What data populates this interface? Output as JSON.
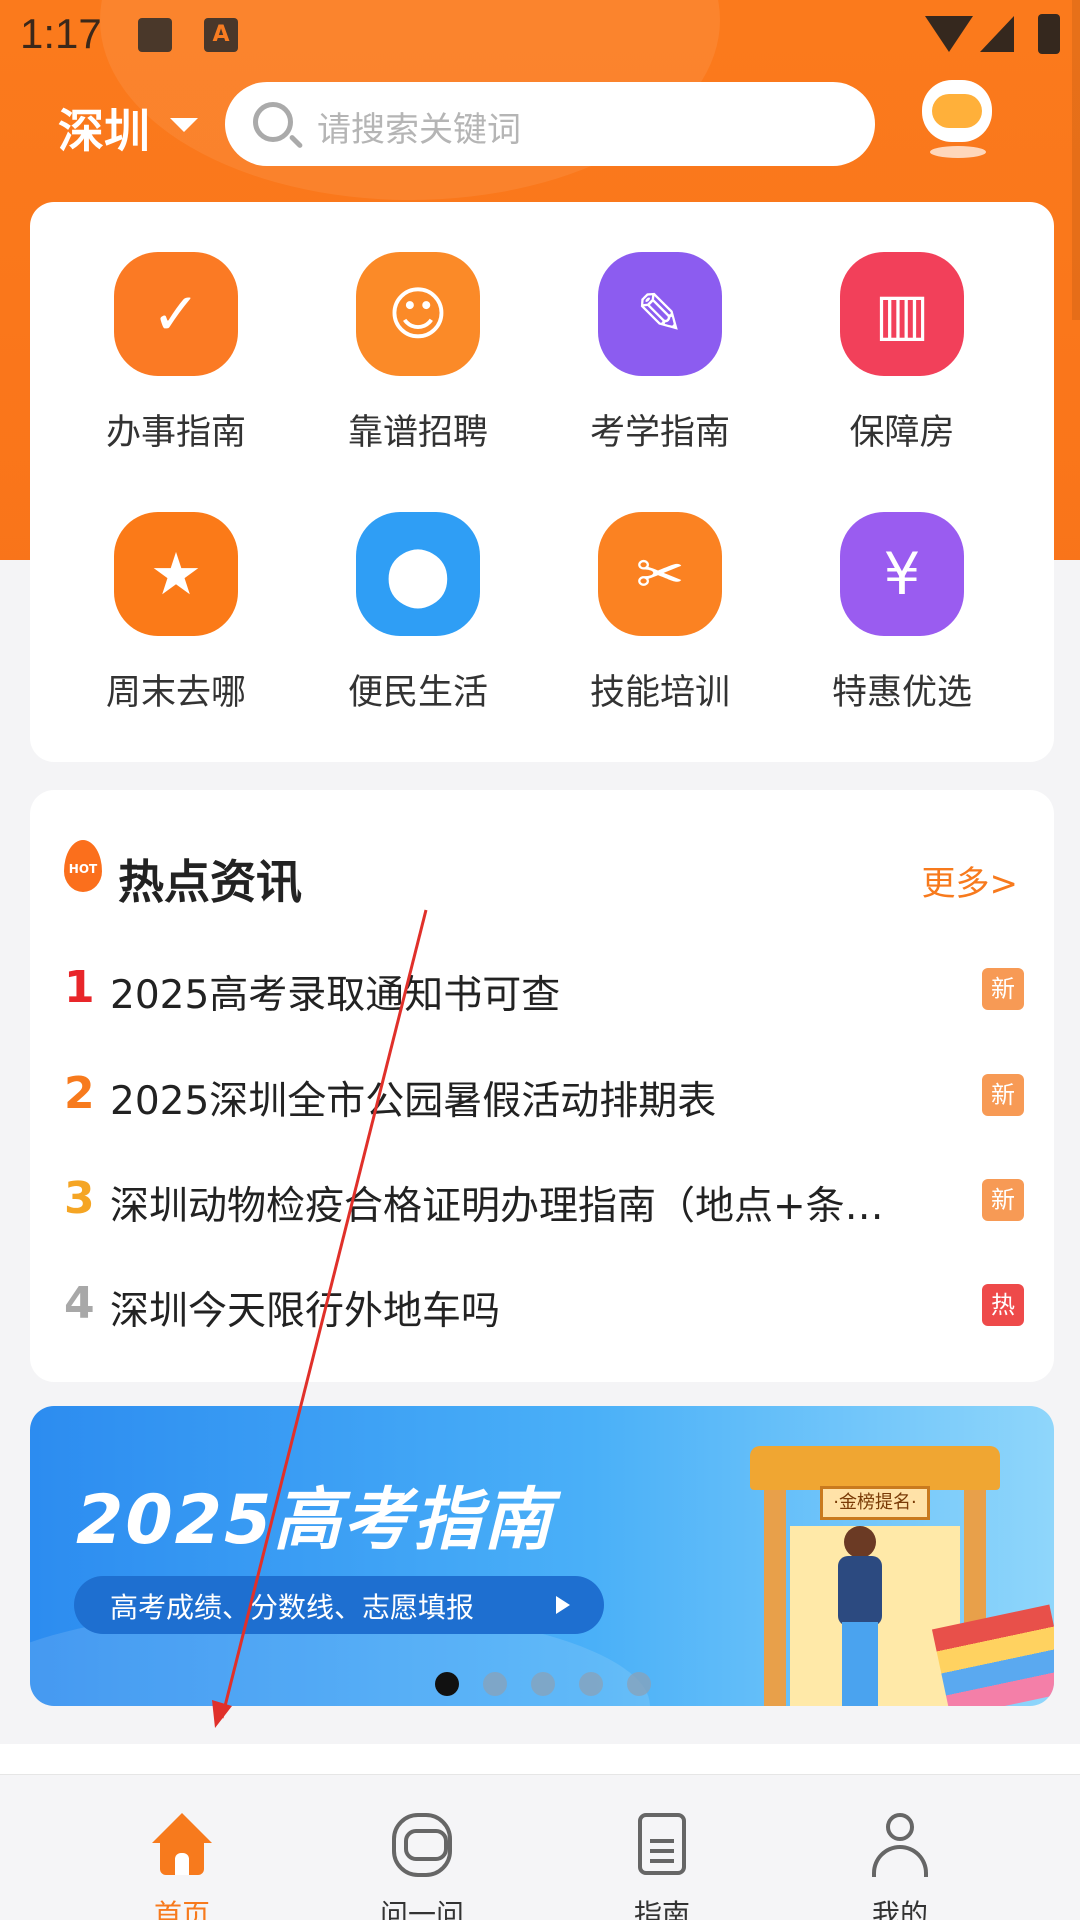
{
  "status_bar": {
    "time": "1:17",
    "a_icon": "A"
  },
  "header": {
    "city": "深圳",
    "search_placeholder": "请搜索关键词"
  },
  "services": [
    {
      "label": "办事指南",
      "icon": "calendar-check-icon",
      "color": "#fb7a24",
      "glyph": "✓"
    },
    {
      "label": "靠谱招聘",
      "icon": "person-tie-icon",
      "color": "#fb8a28",
      "glyph": "☺"
    },
    {
      "label": "考学指南",
      "icon": "folder-pen-icon",
      "color": "#8c5cf0",
      "glyph": "✎"
    },
    {
      "label": "保障房",
      "icon": "building-icon",
      "color": "#f2405a",
      "glyph": "▥"
    },
    {
      "label": "周末去哪",
      "icon": "bookmark-star-icon",
      "color": "#fb7a18",
      "glyph": "★"
    },
    {
      "label": "便民生活",
      "icon": "location-pin-icon",
      "color": "#2f9ef5",
      "glyph": "⬤"
    },
    {
      "label": "技能培训",
      "icon": "tools-bulb-icon",
      "color": "#fb8222",
      "glyph": "✂"
    },
    {
      "label": "特惠优选",
      "icon": "coupon-icon",
      "color": "#9a5cf0",
      "glyph": "¥"
    }
  ],
  "hot_news": {
    "hot_badge": "HOT",
    "title": "热点资讯",
    "more": "更多>",
    "items": [
      {
        "rank": "1",
        "text": "2025高考录取通知书可查",
        "tag": "新",
        "rank_color": "#e8262a",
        "tag_color": "#f79a55"
      },
      {
        "rank": "2",
        "text": "2025深圳全市公园暑假活动排期表",
        "tag": "新",
        "rank_color": "#f77a1d",
        "tag_color": "#f79a55"
      },
      {
        "rank": "3",
        "text": "深圳动物检疫合格证明办理指南（地点+条…",
        "tag": "新",
        "rank_color": "#f5a524",
        "tag_color": "#f79a55"
      },
      {
        "rank": "4",
        "text": "深圳今天限行外地车吗",
        "tag": "热",
        "rank_color": "#a8a8a8",
        "tag_color": "#ee4a4a"
      }
    ]
  },
  "banner": {
    "title": "2025高考指南",
    "subtitle": "高考成绩、分数线、志愿填报",
    "plaque": "·金榜提名·",
    "page_count": 5,
    "active_page": 1
  },
  "tabbar": {
    "items": [
      {
        "label": "首页",
        "icon": "home-icon",
        "active": true
      },
      {
        "label": "问一问",
        "icon": "robot-icon",
        "active": false
      },
      {
        "label": "指南",
        "icon": "document-icon",
        "active": false
      },
      {
        "label": "我的",
        "icon": "user-icon",
        "active": false
      }
    ]
  },
  "colors": {
    "accent": "#f77a1d",
    "hero_bg": "#fb7a1c",
    "annotation": "#e0302a"
  }
}
